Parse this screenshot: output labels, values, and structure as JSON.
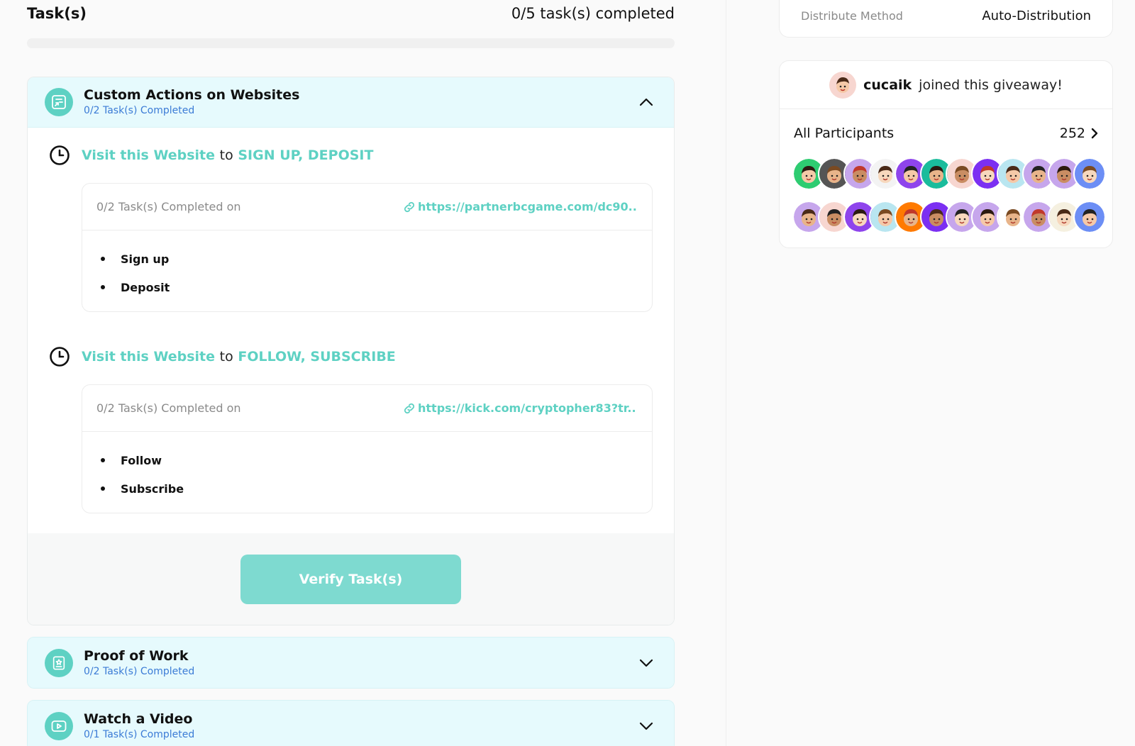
{
  "tasks": {
    "title": "Task(s)",
    "completed_summary": "0/5 task(s) completed",
    "progress_fraction": 0
  },
  "groups": [
    {
      "title": "Custom Actions on Websites",
      "subtitle": "0/2 Task(s) Completed",
      "icon": "form-icon",
      "expanded": true,
      "tasks": [
        {
          "link_label": "Visit this Website",
          "connector": "to",
          "action": "SIGN UP, DEPOSIT",
          "card_label": "0/2 Task(s) Completed on",
          "url": "https://partnerbcgame.com/dc90...",
          "items": [
            "Sign up",
            "Deposit"
          ]
        },
        {
          "link_label": "Visit this Website",
          "connector": "to",
          "action": "FOLLOW, SUBSCRIBE",
          "card_label": "0/2 Task(s) Completed on",
          "url": "https://kick.com/cryptopher83?tr...",
          "items": [
            "Follow",
            "Subscribe"
          ]
        }
      ],
      "verify_label": "Verify Task(s)"
    },
    {
      "title": "Proof of Work",
      "subtitle": "0/2 Task(s) Completed",
      "icon": "proof-document-icon",
      "expanded": false
    },
    {
      "title": "Watch a Video",
      "subtitle": "0/1 Task(s) Completed",
      "icon": "video-play-icon",
      "expanded": false
    }
  ],
  "distribution": {
    "label": "Distribute Method",
    "value": "Auto-Distribution"
  },
  "participants": {
    "recent_user": "cucaik",
    "recent_text": "joined this giveaway!",
    "all_label": "All Participants",
    "count": "252",
    "avatar_colors": [
      [
        "#2ecc71",
        "#555555",
        "#c6a6ec",
        "#f3f3f3",
        "#8e44ec",
        "#1abc9c",
        "#f7d6d0",
        "#7b2ff2",
        "#b9e6f0",
        "#c6a6ec",
        "#c6a6ec",
        "#6c8ef5"
      ],
      [
        "#c6a6ec",
        "#f7d6d0",
        "#8e44ec",
        "#b9e6f0",
        "#ff7a00",
        "#7b2ff2",
        "#c6a6ec",
        "#c6a6ec",
        "#ffffff",
        "#c6a6ec",
        "#f5f0e0",
        "#6c8ef5"
      ]
    ]
  },
  "colors": {
    "accent": "#5ed1c3",
    "accent_button": "#7edad0",
    "subtitle_blue": "#3b7bd6",
    "header_bg": "#e6fafd"
  }
}
